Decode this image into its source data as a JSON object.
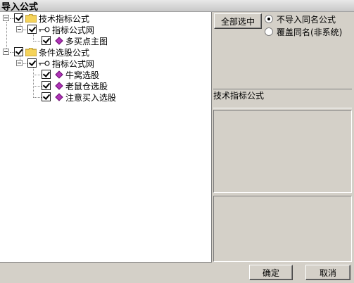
{
  "window": {
    "title": "导入公式"
  },
  "tree": {
    "nodes": [
      {
        "label": "技术指标公式",
        "type": "folder"
      },
      {
        "label": "指标公式网",
        "type": "key"
      },
      {
        "label": "多买点主图",
        "type": "item"
      },
      {
        "label": "条件选股公式",
        "type": "folder"
      },
      {
        "label": "指标公式网",
        "type": "key"
      },
      {
        "label": "牛窝选股",
        "type": "item"
      },
      {
        "label": "老鼠仓选股",
        "type": "item"
      },
      {
        "label": "注意买入选股",
        "type": "item"
      }
    ]
  },
  "options": {
    "select_all_label": "全部选中",
    "radio_skip_label": "不导入同名公式",
    "radio_overwrite_label": "覆盖同名(非系统)",
    "selected": "skip"
  },
  "formula_panel": {
    "title": "技术指标公式"
  },
  "footer": {
    "ok_label": "确定",
    "cancel_label": "取消"
  },
  "colors": {
    "gem": "#b033b8",
    "folder": "#f5d35a"
  }
}
